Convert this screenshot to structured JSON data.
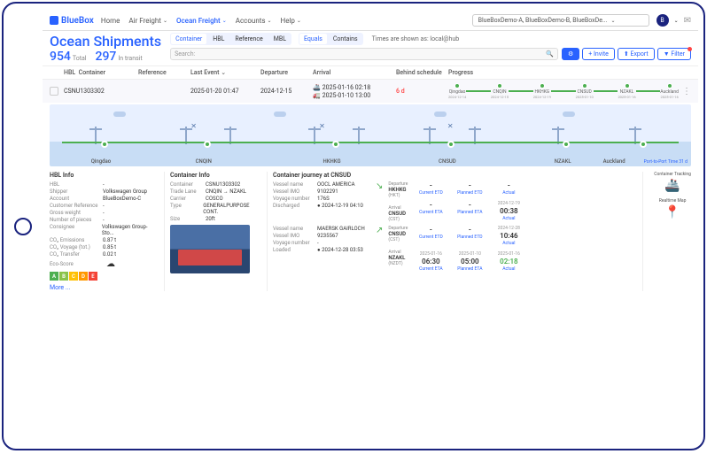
{
  "logo": "BlueBox",
  "nav": {
    "home": "Home",
    "air": "Air Freight",
    "ocean": "Ocean Freight",
    "accounts": "Accounts",
    "help": "Help"
  },
  "account_selector": "BlueBoxDemo-A, BlueBoxDemo-B, BlueBoxDe...",
  "avatar_letter": "B",
  "title": "Ocean Shipments",
  "stats": {
    "total_n": "954",
    "total_l": "Total",
    "transit_n": "297",
    "transit_l": "In transit"
  },
  "filter_pills": [
    "Container",
    "HBL",
    "Reference",
    "MBL"
  ],
  "search_placeholder": "Search:",
  "eq_pills": [
    "Equals",
    "Contains"
  ],
  "tz": "Times are shown as:  local@hub",
  "actions": {
    "settings": "⚙",
    "invite": "+ Invite",
    "export": "⬆ Export",
    "filter": "▼ Filter"
  },
  "cols": {
    "hbl": "HBL",
    "container": "Container",
    "ref": "Reference",
    "evt": "Last Event",
    "dep": "Departure",
    "arr": "Arrival",
    "bhd": "Behind schedule",
    "prog": "Progress"
  },
  "row": {
    "container": "CSNU1303302",
    "evt": "2025-01-20 01:47",
    "dep": "2024-12-15",
    "arr1": "2025-01-16 02:18",
    "arr2": "2025-01-10 13:00",
    "bhd": "6 d",
    "nodes": [
      {
        "n": "Qingdao",
        "d": "2024-12-14"
      },
      {
        "n": "CNQIN",
        "d": "2024-12-15"
      },
      {
        "n": "HKHKG",
        "d": "2024-12-19"
      },
      {
        "n": "CNSUD",
        "d": "2025-01-10"
      },
      {
        "n": "NZAKL",
        "d": "2025-01-16"
      },
      {
        "n": "Auckland",
        "d": "2025-01-16"
      }
    ]
  },
  "journey_ports": [
    "Qingdao",
    "CNQIN",
    "HKHKG",
    "CNSUD",
    "NZAKL",
    "Auckland"
  ],
  "ptp": "Port-to-Port Time 31 d",
  "hbl_info": {
    "title": "HBL Info",
    "rows": [
      [
        "HBL",
        "-"
      ],
      [
        "Shipper",
        "Volkswagen Group"
      ],
      [
        "Account",
        "BlueBoxDemo-C"
      ],
      [
        "Customer Reference",
        "-"
      ],
      [
        "Gross weight",
        "-"
      ],
      [
        "Number of pieces",
        "-"
      ],
      [
        "Consignee",
        "Volkswagen Group-Sto..."
      ],
      [
        "CO₂ Emissions",
        "0.87 t"
      ],
      [
        "CO₂ Voyage (tot.)",
        "0.85 t"
      ],
      [
        "CO₂ Transfer",
        "0.02 t"
      ]
    ],
    "eco_lbl": "Eco-Score",
    "more": "More ..."
  },
  "cont_info": {
    "title": "Container Info",
    "rows": [
      [
        "Container",
        "CSNU1303302"
      ],
      [
        "Trade Lane",
        "CNQIN → NZAKL"
      ],
      [
        "Carrier",
        "COSCO"
      ],
      [
        "Type",
        "GENERALPURPOSE CONT."
      ],
      [
        "Size",
        "20ft"
      ]
    ]
  },
  "journey": {
    "title": "Container journey at CNSUD",
    "v1": {
      "rows": [
        [
          "Vessel name",
          "OOCL AMERICA"
        ],
        [
          "Vessel IMO",
          "9102291"
        ],
        [
          "Voyage number",
          "176S"
        ],
        [
          "Discharged",
          "● 2024-12-19 04:10"
        ]
      ],
      "dep": {
        "lbl": "Departure",
        "port": "HKHKG",
        "tz": "(HKT)"
      },
      "arr": {
        "lbl": "Arrival",
        "port": "CNSUD",
        "tz": "(CST)"
      },
      "times_dep": [
        [
          "-",
          "Current ETD"
        ],
        [
          "-",
          "Planned ETD"
        ],
        [
          "-",
          "Actual"
        ]
      ],
      "times_arr": [
        [
          "-",
          "Current ETA"
        ],
        [
          "-",
          "Planned ETA"
        ],
        [
          "00:38",
          "Actual",
          "2024-12-19"
        ]
      ]
    },
    "v2": {
      "rows": [
        [
          "Vessel name",
          "MAERSK GAIRLOCH"
        ],
        [
          "Vessel IMO",
          "9235567"
        ],
        [
          "Voyage number",
          "-"
        ],
        [
          "Loaded",
          "● 2024-12-28 03:53"
        ]
      ],
      "dep": {
        "lbl": "Departure",
        "port": "CNSUD",
        "tz": "(CST)"
      },
      "arr": {
        "lbl": "Arrival",
        "port": "NZAKL",
        "tz": "(NZDT)"
      },
      "times_dep": [
        [
          "-",
          "Current ETD"
        ],
        [
          "-",
          "Planned ETD"
        ],
        [
          "10:46",
          "Actual",
          "2024-12-28"
        ]
      ],
      "times_arr": [
        [
          "06:30",
          "Current ETA",
          "2025-01-16"
        ],
        [
          "05:00",
          "Planned ETA",
          "2025-01-10"
        ],
        [
          "02:18",
          "Actual",
          "2025-01-16"
        ]
      ]
    }
  },
  "tools": {
    "track": "Container Tracking",
    "map": "Realtime Map"
  }
}
